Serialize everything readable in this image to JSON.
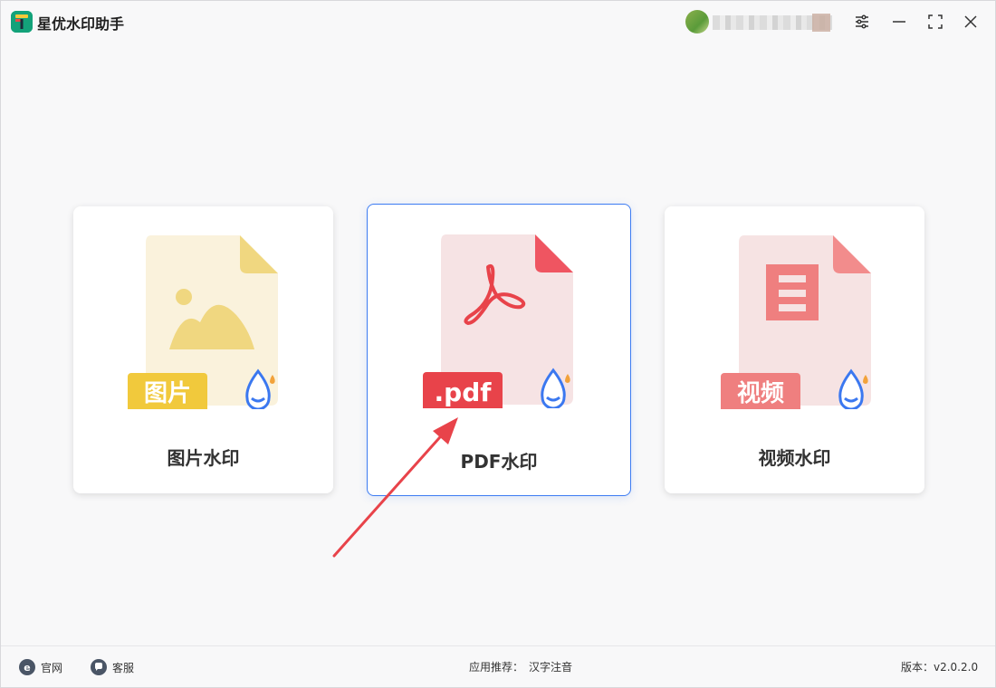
{
  "app": {
    "title": "星优水印助手"
  },
  "window_controls": {
    "settings_icon": "settings-sliders-icon",
    "minimize_icon": "minimize-icon",
    "maximize_icon": "maximize-icon",
    "close_icon": "close-icon"
  },
  "cards": [
    {
      "label": "图片水印",
      "badge": "图片",
      "accent": "#f1c93c",
      "paper": "#faf2dc",
      "fold": "#f0d780",
      "icon": "image-file-icon",
      "selected": false
    },
    {
      "label": "PDF水印",
      "badge": ".pdf",
      "accent": "#e8434a",
      "paper": "#f6e3e4",
      "fold": "#ef5561",
      "icon": "pdf-file-icon",
      "selected": true
    },
    {
      "label": "视频水印",
      "badge": "视频",
      "accent": "#ef7f7f",
      "paper": "#f6e3e3",
      "fold": "#f28c8c",
      "icon": "video-file-icon",
      "selected": false
    }
  ],
  "footer": {
    "website_label": "官网",
    "support_label": "客服",
    "recommend_label": "应用推荐：",
    "recommend_app": "汉字注音",
    "version_label": "版本：v2.0.2.0"
  },
  "colors": {
    "selection_border": "#3d7cf2",
    "annotation_arrow": "#e8434a",
    "water_drop": "#3b78f0"
  }
}
